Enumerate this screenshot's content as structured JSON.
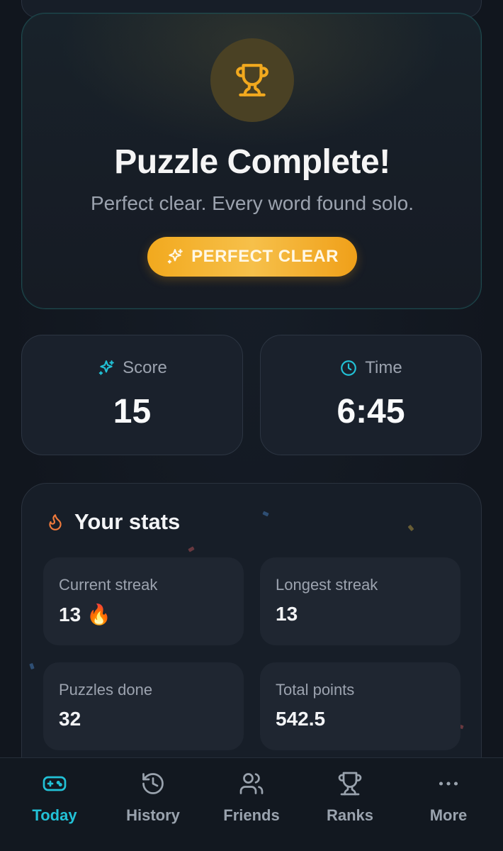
{
  "hero": {
    "title": "Puzzle Complete!",
    "subtitle": "Perfect clear. Every word found solo.",
    "badge_label": "PERFECT CLEAR"
  },
  "score": {
    "label": "Score",
    "value": "15"
  },
  "time": {
    "label": "Time",
    "value": "6:45"
  },
  "stats": {
    "title": "Your stats",
    "tiles": [
      {
        "label": "Current streak",
        "value": "13",
        "emoji": "🔥"
      },
      {
        "label": "Longest streak",
        "value": "13"
      },
      {
        "label": "Puzzles done",
        "value": "32"
      },
      {
        "label": "Total points",
        "value": "542.5"
      }
    ]
  },
  "nav": {
    "items": [
      {
        "label": "Today",
        "icon": "gamepad-icon",
        "active": true
      },
      {
        "label": "History",
        "icon": "history-icon"
      },
      {
        "label": "Friends",
        "icon": "friends-icon"
      },
      {
        "label": "Ranks",
        "icon": "trophy-icon"
      },
      {
        "label": "More",
        "icon": "more-icon"
      }
    ]
  },
  "colors": {
    "accent": "#22c1d6",
    "gold": "#f2a91e",
    "flame": "#f07a3c"
  }
}
